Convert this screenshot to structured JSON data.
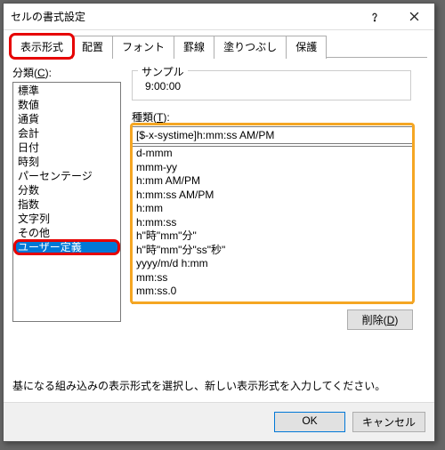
{
  "window": {
    "title": "セルの書式設定"
  },
  "tabs": {
    "items": [
      "表示形式",
      "配置",
      "フォント",
      "罫線",
      "塗りつぶし",
      "保護"
    ],
    "active": 0
  },
  "category": {
    "label_pre": "分類(",
    "label_key": "C",
    "label_post": "):",
    "items": [
      "標準",
      "数値",
      "通貨",
      "会計",
      "日付",
      "時刻",
      "パーセンテージ",
      "分数",
      "指数",
      "文字列",
      "その他",
      "ユーザー定義"
    ],
    "selected": 11
  },
  "sample": {
    "label": "サンプル",
    "value": "9:00:00"
  },
  "type": {
    "label_pre": "種類(",
    "label_key": "T",
    "label_post": "):",
    "value": "[$-x-systime]h:mm:ss AM/PM"
  },
  "formats": [
    "d-mmm",
    "mmm-yy",
    "h:mm AM/PM",
    "h:mm:ss AM/PM",
    "h:mm",
    "h:mm:ss",
    "h\"時\"mm\"分\"",
    "h\"時\"mm\"分\"ss\"秒\"",
    "yyyy/m/d h:mm",
    "mm:ss",
    "mm:ss.0"
  ],
  "delete": {
    "pre": "削除(",
    "key": "D",
    "post": ")"
  },
  "hint": "基になる組み込みの表示形式を選択し、新しい表示形式を入力してください。",
  "footer": {
    "ok": "OK",
    "cancel": "キャンセル"
  }
}
